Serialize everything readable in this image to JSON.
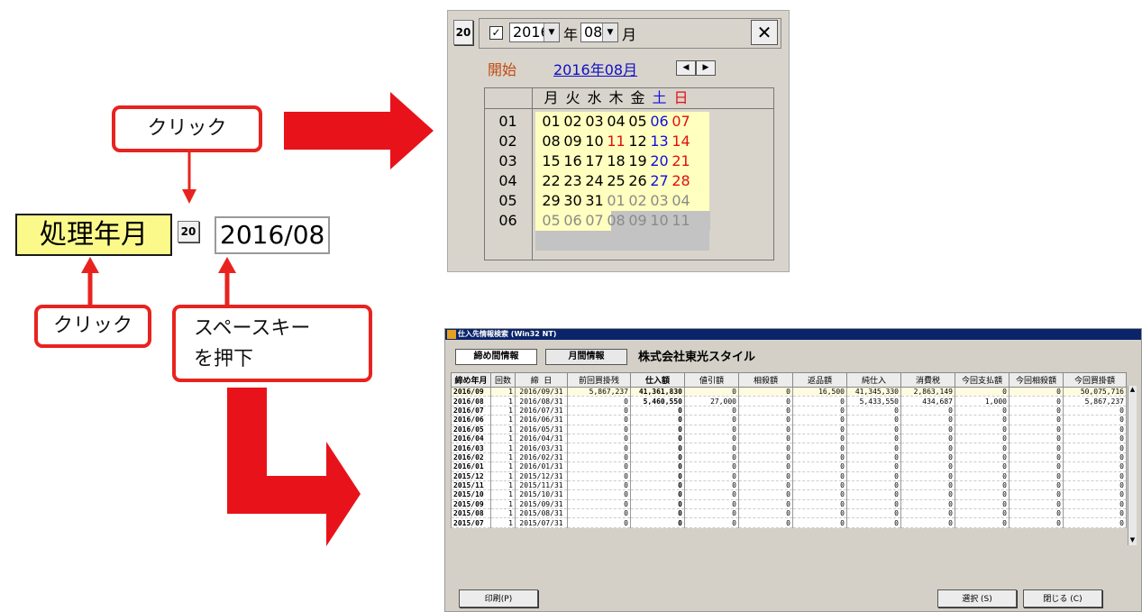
{
  "callouts": {
    "click_top": "クリック",
    "click_bottom": "クリック",
    "space_line1": "スペースキー",
    "space_line2": "を押下"
  },
  "field": {
    "label": "処理年月",
    "cal_icon": "20",
    "value": "2016/08"
  },
  "calendar": {
    "icon": "20",
    "year": "2016",
    "year_suffix": "年",
    "month": "08",
    "month_suffix": "月",
    "close": "✕",
    "start_label": "開始",
    "current": "2016年08月",
    "weekdays": [
      "月",
      "火",
      "水",
      "木",
      "金",
      "土",
      "日"
    ],
    "weeks": [
      {
        "no": "01",
        "days": [
          "01",
          "02",
          "03",
          "04",
          "05",
          "06",
          "07"
        ]
      },
      {
        "no": "02",
        "days": [
          "08",
          "09",
          "10",
          "11",
          "12",
          "13",
          "14"
        ]
      },
      {
        "no": "03",
        "days": [
          "15",
          "16",
          "17",
          "18",
          "19",
          "20",
          "21"
        ]
      },
      {
        "no": "04",
        "days": [
          "22",
          "23",
          "24",
          "25",
          "26",
          "27",
          "28"
        ]
      },
      {
        "no": "05",
        "days": [
          "29",
          "30",
          "31",
          "01",
          "02",
          "03",
          "04"
        ]
      },
      {
        "no": "06",
        "days": [
          "05",
          "06",
          "07",
          "08",
          "09",
          "10",
          "11"
        ]
      }
    ],
    "colors": {
      "sat": "#1010e0",
      "sun": "#e01010",
      "holiday": "#e01010",
      "highlight": "#ffffbf"
    }
  },
  "window": {
    "title": "仕入先情報検索 (Win32 NT)",
    "tabs": [
      "締め間情報",
      "月間情報"
    ],
    "company": "株式会社東光スタイル",
    "columns": [
      "締め年月",
      "回数",
      "締 日",
      "前回買掛残",
      "仕入額",
      "値引額",
      "相殺額",
      "返品額",
      "純仕入",
      "消費税",
      "今回支払額",
      "今回相殺額",
      "今回買掛額"
    ],
    "rows": [
      [
        "2016/09",
        "1",
        "2016/09/31",
        "5,867,237",
        "41,361,830",
        "0",
        "0",
        "16,500",
        "41,345,330",
        "2,863,149",
        "0",
        "0",
        "50,075,716"
      ],
      [
        "2016/08",
        "1",
        "2016/08/31",
        "0",
        "5,460,550",
        "27,000",
        "0",
        "0",
        "5,433,550",
        "434,687",
        "1,000",
        "0",
        "5,867,237"
      ],
      [
        "2016/07",
        "1",
        "2016/07/31",
        "0",
        "0",
        "0",
        "0",
        "0",
        "0",
        "0",
        "0",
        "0",
        "0"
      ],
      [
        "2016/06",
        "1",
        "2016/06/31",
        "0",
        "0",
        "0",
        "0",
        "0",
        "0",
        "0",
        "0",
        "0",
        "0"
      ],
      [
        "2016/05",
        "1",
        "2016/05/31",
        "0",
        "0",
        "0",
        "0",
        "0",
        "0",
        "0",
        "0",
        "0",
        "0"
      ],
      [
        "2016/04",
        "1",
        "2016/04/31",
        "0",
        "0",
        "0",
        "0",
        "0",
        "0",
        "0",
        "0",
        "0",
        "0"
      ],
      [
        "2016/03",
        "1",
        "2016/03/31",
        "0",
        "0",
        "0",
        "0",
        "0",
        "0",
        "0",
        "0",
        "0",
        "0"
      ],
      [
        "2016/02",
        "1",
        "2016/02/31",
        "0",
        "0",
        "0",
        "0",
        "0",
        "0",
        "0",
        "0",
        "0",
        "0"
      ],
      [
        "2016/01",
        "1",
        "2016/01/31",
        "0",
        "0",
        "0",
        "0",
        "0",
        "0",
        "0",
        "0",
        "0",
        "0"
      ],
      [
        "2015/12",
        "1",
        "2015/12/31",
        "0",
        "0",
        "0",
        "0",
        "0",
        "0",
        "0",
        "0",
        "0",
        "0"
      ],
      [
        "2015/11",
        "1",
        "2015/11/31",
        "0",
        "0",
        "0",
        "0",
        "0",
        "0",
        "0",
        "0",
        "0",
        "0"
      ],
      [
        "2015/10",
        "1",
        "2015/10/31",
        "0",
        "0",
        "0",
        "0",
        "0",
        "0",
        "0",
        "0",
        "0",
        "0"
      ],
      [
        "2015/09",
        "1",
        "2015/09/31",
        "0",
        "0",
        "0",
        "0",
        "0",
        "0",
        "0",
        "0",
        "0",
        "0"
      ],
      [
        "2015/08",
        "1",
        "2015/08/31",
        "0",
        "0",
        "0",
        "0",
        "0",
        "0",
        "0",
        "0",
        "0",
        "0"
      ],
      [
        "2015/07",
        "1",
        "2015/07/31",
        "0",
        "0",
        "0",
        "0",
        "0",
        "0",
        "0",
        "0",
        "0",
        "0"
      ]
    ],
    "buttons": {
      "print": "印刷(P)",
      "select": "選択 (S)",
      "close": "閉じる (C)"
    }
  }
}
